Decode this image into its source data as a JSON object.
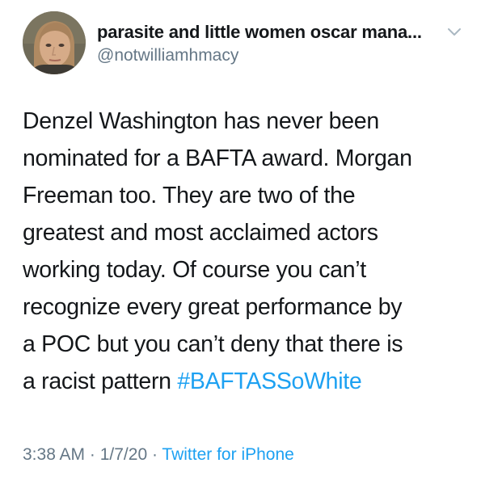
{
  "header": {
    "display_name": "parasite and little women oscar mana...",
    "handle": "@notwilliamhmacy"
  },
  "tweet": {
    "lines": [
      "Denzel Washington has never been",
      "nominated for a BAFTA award. Morgan",
      "Freeman too. They are two of the",
      "greatest and most acclaimed actors",
      "working today. Of course you can’t",
      "recognize every great performance by",
      "a POC but you can’t deny that there is",
      "a racist pattern "
    ],
    "hashtag": "#BAFTASSoWhite"
  },
  "meta": {
    "time": "3:38 AM",
    "separator": " · ",
    "date": "1/7/20",
    "source": "Twitter for iPhone"
  },
  "icons": {
    "avatar": "profile-photo",
    "chevron": "chevron-down-icon"
  },
  "colors": {
    "text": "#14171a",
    "secondary": "#657786",
    "link": "#1da1f2",
    "chevron": "#aab8c2"
  }
}
